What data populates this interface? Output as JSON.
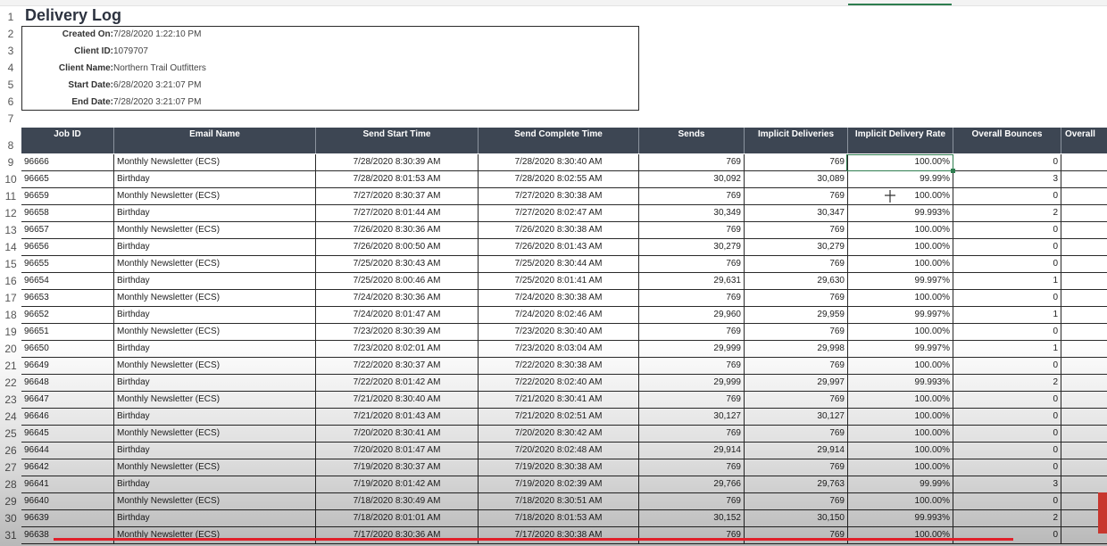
{
  "sheet": {
    "title": "Delivery Log",
    "metadata": [
      {
        "label": "Created On:",
        "value": "7/28/2020 1:22:10 PM"
      },
      {
        "label": "Client ID:",
        "value": "1079707"
      },
      {
        "label": "Client Name:",
        "value": "Northern Trail Outfitters"
      },
      {
        "label": "Start Date:",
        "value": "6/28/2020 3:21:07 PM"
      },
      {
        "label": "End Date:",
        "value": "7/28/2020 3:21:07 PM"
      }
    ],
    "columns": [
      "Job ID",
      "Email Name",
      "Send Start Time",
      "Send Complete Time",
      "Sends",
      "Implicit Deliveries",
      "Implicit Delivery Rate",
      "Overall Bounces",
      "Overall"
    ],
    "row_numbers": [
      "1",
      "2",
      "3",
      "4",
      "5",
      "6",
      "7",
      "8",
      "9",
      "10",
      "11",
      "12",
      "13",
      "14",
      "15",
      "16",
      "17",
      "18",
      "19",
      "20",
      "21",
      "22",
      "23",
      "24",
      "25",
      "26",
      "27",
      "28",
      "29",
      "30",
      "31"
    ],
    "rows": [
      [
        "96666",
        "Monthly Newsletter (ECS)",
        "7/28/2020 8:30:39 AM",
        "7/28/2020 8:30:40 AM",
        "769",
        "769",
        "100.00%",
        "0",
        ""
      ],
      [
        "96665",
        "Birthday",
        "7/28/2020 8:01:53 AM",
        "7/28/2020 8:02:55 AM",
        "30,092",
        "30,089",
        "99.99%",
        "3",
        ""
      ],
      [
        "96659",
        "Monthly Newsletter (ECS)",
        "7/27/2020 8:30:37 AM",
        "7/27/2020 8:30:38 AM",
        "769",
        "769",
        "100.00%",
        "0",
        ""
      ],
      [
        "96658",
        "Birthday",
        "7/27/2020 8:01:44 AM",
        "7/27/2020 8:02:47 AM",
        "30,349",
        "30,347",
        "99.993%",
        "2",
        ""
      ],
      [
        "96657",
        "Monthly Newsletter (ECS)",
        "7/26/2020 8:30:36 AM",
        "7/26/2020 8:30:38 AM",
        "769",
        "769",
        "100.00%",
        "0",
        ""
      ],
      [
        "96656",
        "Birthday",
        "7/26/2020 8:00:50 AM",
        "7/26/2020 8:01:43 AM",
        "30,279",
        "30,279",
        "100.00%",
        "0",
        ""
      ],
      [
        "96655",
        "Monthly Newsletter (ECS)",
        "7/25/2020 8:30:43 AM",
        "7/25/2020 8:30:44 AM",
        "769",
        "769",
        "100.00%",
        "0",
        ""
      ],
      [
        "96654",
        "Birthday",
        "7/25/2020 8:00:46 AM",
        "7/25/2020 8:01:41 AM",
        "29,631",
        "29,630",
        "99.997%",
        "1",
        ""
      ],
      [
        "96653",
        "Monthly Newsletter (ECS)",
        "7/24/2020 8:30:36 AM",
        "7/24/2020 8:30:38 AM",
        "769",
        "769",
        "100.00%",
        "0",
        ""
      ],
      [
        "96652",
        "Birthday",
        "7/24/2020 8:01:47 AM",
        "7/24/2020 8:02:46 AM",
        "29,960",
        "29,959",
        "99.997%",
        "1",
        ""
      ],
      [
        "96651",
        "Monthly Newsletter (ECS)",
        "7/23/2020 8:30:39 AM",
        "7/23/2020 8:30:40 AM",
        "769",
        "769",
        "100.00%",
        "0",
        ""
      ],
      [
        "96650",
        "Birthday",
        "7/23/2020 8:02:01 AM",
        "7/23/2020 8:03:04 AM",
        "29,999",
        "29,998",
        "99.997%",
        "1",
        ""
      ],
      [
        "96649",
        "Monthly Newsletter (ECS)",
        "7/22/2020 8:30:37 AM",
        "7/22/2020 8:30:38 AM",
        "769",
        "769",
        "100.00%",
        "0",
        ""
      ],
      [
        "96648",
        "Birthday",
        "7/22/2020 8:01:42 AM",
        "7/22/2020 8:02:40 AM",
        "29,999",
        "29,997",
        "99.993%",
        "2",
        ""
      ],
      [
        "96647",
        "Monthly Newsletter (ECS)",
        "7/21/2020 8:30:40 AM",
        "7/21/2020 8:30:41 AM",
        "769",
        "769",
        "100.00%",
        "0",
        ""
      ],
      [
        "96646",
        "Birthday",
        "7/21/2020 8:01:43 AM",
        "7/21/2020 8:02:51 AM",
        "30,127",
        "30,127",
        "100.00%",
        "0",
        ""
      ],
      [
        "96645",
        "Monthly Newsletter (ECS)",
        "7/20/2020 8:30:41 AM",
        "7/20/2020 8:30:42 AM",
        "769",
        "769",
        "100.00%",
        "0",
        ""
      ],
      [
        "96644",
        "Birthday",
        "7/20/2020 8:01:47 AM",
        "7/20/2020 8:02:48 AM",
        "29,914",
        "29,914",
        "100.00%",
        "0",
        ""
      ],
      [
        "96642",
        "Monthly Newsletter (ECS)",
        "7/19/2020 8:30:37 AM",
        "7/19/2020 8:30:38 AM",
        "769",
        "769",
        "100.00%",
        "0",
        ""
      ],
      [
        "96641",
        "Birthday",
        "7/19/2020 8:01:42 AM",
        "7/19/2020 8:02:39 AM",
        "29,766",
        "29,763",
        "99.99%",
        "3",
        ""
      ],
      [
        "96640",
        "Monthly Newsletter (ECS)",
        "7/18/2020 8:30:49 AM",
        "7/18/2020 8:30:51 AM",
        "769",
        "769",
        "100.00%",
        "0",
        ""
      ],
      [
        "96639",
        "Birthday",
        "7/18/2020 8:01:01 AM",
        "7/18/2020 8:01:53 AM",
        "30,152",
        "30,150",
        "99.993%",
        "2",
        ""
      ],
      [
        "96638",
        "Monthly Newsletter (ECS)",
        "7/17/2020 8:30:36 AM",
        "7/17/2020 8:30:38 AM",
        "769",
        "769",
        "100.00%",
        "0",
        ""
      ]
    ],
    "selected_cell": {
      "row": "9",
      "column": "Implicit Delivery Rate"
    },
    "colors": {
      "header_bg": "#3d4653",
      "header_text": "#ffffff",
      "selection": "#2e7d4f",
      "annotation_red": "#e0202a"
    },
    "icons": [
      "move-cursor-icon"
    ]
  }
}
